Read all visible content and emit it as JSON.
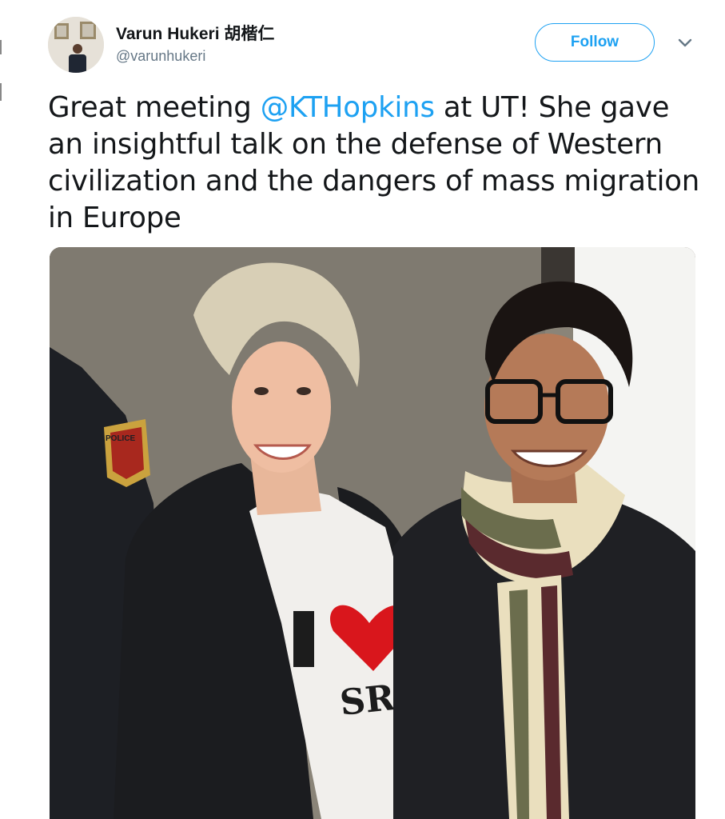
{
  "tweet": {
    "author": {
      "display_name": "Varun Hukeri 胡楷仁",
      "handle": "@varunhukeri"
    },
    "follow_label": "Follow",
    "text": {
      "part1": "Great meeting ",
      "mention": "@KTHopkins",
      "part2": " at UT! She gave an insightful talk on the defense of Western civilization and the dangers of mass migration in Europe"
    },
    "photo": {
      "patch_text": "POLICE",
      "shirt_text": "I ♥ ISRAEL",
      "shirt_visible_text": "SRAE"
    }
  },
  "colors": {
    "accent": "#1da1f2",
    "text": "#14171a",
    "secondary": "#657786"
  },
  "icons": [
    "chevron-down-icon"
  ]
}
